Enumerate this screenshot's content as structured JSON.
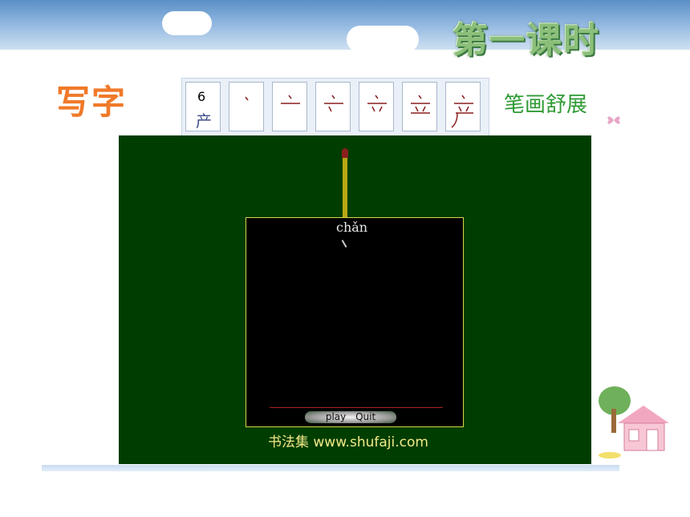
{
  "header": {
    "title": "第一课时"
  },
  "lesson": {
    "heading": "写字",
    "tip": "笔画舒展"
  },
  "stroke_strip": {
    "count": "6",
    "char": "产"
  },
  "board": {
    "pinyin": "chǎn",
    "play_label": "play",
    "quit_label": "Quit",
    "site": "书法集 www.shufaji.com"
  },
  "colors": {
    "title": "#8bbf7a",
    "heading": "#f07a2a",
    "tip": "#2f9a34",
    "board": "#003d00"
  }
}
